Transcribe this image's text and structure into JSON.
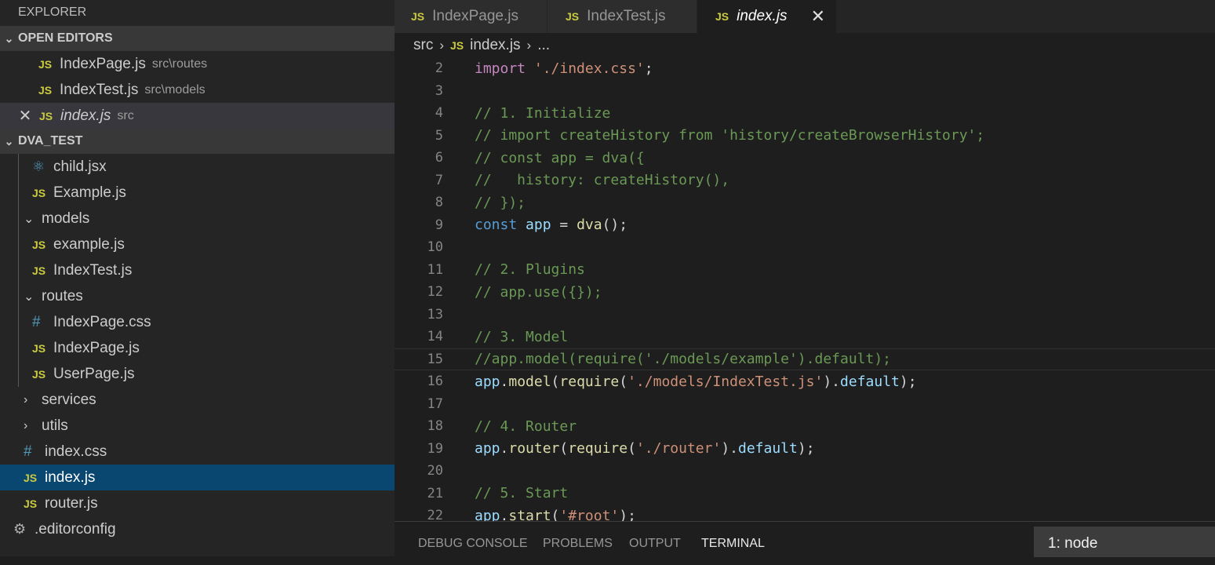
{
  "explorer": {
    "title": "EXPLORER",
    "open_editors": {
      "header": "OPEN EDITORS",
      "items": [
        {
          "name": "IndexPage.js",
          "path": "src\\routes"
        },
        {
          "name": "IndexTest.js",
          "path": "src\\models"
        },
        {
          "name": "index.js",
          "path": "src"
        }
      ]
    },
    "project": {
      "header": "DVA_TEST",
      "items": [
        {
          "label": "child.jsx",
          "icon": "react-icon"
        },
        {
          "label": "Example.js",
          "icon": "js-icon"
        },
        {
          "label": "models",
          "icon": "chevron-down-icon"
        },
        {
          "label": "example.js",
          "icon": "js-icon"
        },
        {
          "label": "IndexTest.js",
          "icon": "js-icon"
        },
        {
          "label": "routes",
          "icon": "chevron-down-icon"
        },
        {
          "label": "IndexPage.css",
          "icon": "css-icon"
        },
        {
          "label": "IndexPage.js",
          "icon": "js-icon"
        },
        {
          "label": "UserPage.js",
          "icon": "js-icon"
        },
        {
          "label": "services",
          "icon": "chevron-right-icon"
        },
        {
          "label": "utils",
          "icon": "chevron-right-icon"
        },
        {
          "label": "index.css",
          "icon": "css-icon"
        },
        {
          "label": "index.js",
          "icon": "js-icon"
        },
        {
          "label": "router.js",
          "icon": "js-icon"
        },
        {
          "label": ".editorconfig",
          "icon": "gear-icon"
        }
      ]
    }
  },
  "icons": {
    "js": "JS",
    "css": "#",
    "react": "⚛",
    "gear": "⚙",
    "close": "✕",
    "chevron_down": "⌄",
    "chevron_right": "›"
  },
  "tabs": [
    {
      "label": "IndexPage.js"
    },
    {
      "label": "IndexTest.js"
    },
    {
      "label": "index.js",
      "active": true
    }
  ],
  "breadcrumb": {
    "folder": "src",
    "file": "index.js",
    "more": "..."
  },
  "editor": {
    "lines": [
      {
        "n": "2",
        "tokens": [
          [
            "kw",
            "import"
          ],
          [
            "plain",
            " "
          ],
          [
            "str",
            "'./index.css'"
          ],
          [
            "plain",
            ";"
          ]
        ]
      },
      {
        "n": "3",
        "tokens": []
      },
      {
        "n": "4",
        "tokens": [
          [
            "comment",
            "// 1. Initialize"
          ]
        ]
      },
      {
        "n": "5",
        "tokens": [
          [
            "comment",
            "// import createHistory from 'history/createBrowserHistory';"
          ]
        ]
      },
      {
        "n": "6",
        "tokens": [
          [
            "comment",
            "// const app = dva({"
          ]
        ]
      },
      {
        "n": "7",
        "tokens": [
          [
            "comment",
            "//   history: createHistory(),"
          ]
        ]
      },
      {
        "n": "8",
        "tokens": [
          [
            "comment",
            "// });"
          ]
        ]
      },
      {
        "n": "9",
        "tokens": [
          [
            "decl",
            "const"
          ],
          [
            "plain",
            " "
          ],
          [
            "var",
            "app"
          ],
          [
            "plain",
            " = "
          ],
          [
            "fn",
            "dva"
          ],
          [
            "plain",
            "();"
          ]
        ]
      },
      {
        "n": "10",
        "tokens": []
      },
      {
        "n": "11",
        "tokens": [
          [
            "comment",
            "// 2. Plugins"
          ]
        ]
      },
      {
        "n": "12",
        "tokens": [
          [
            "comment",
            "// app.use({});"
          ]
        ]
      },
      {
        "n": "13",
        "tokens": []
      },
      {
        "n": "14",
        "tokens": [
          [
            "comment",
            "// 3. Model"
          ]
        ]
      },
      {
        "n": "15",
        "tokens": [
          [
            "comment",
            "//app.model(require('./models/example').default);"
          ]
        ],
        "current": true
      },
      {
        "n": "16",
        "tokens": [
          [
            "var",
            "app"
          ],
          [
            "plain",
            "."
          ],
          [
            "fn",
            "model"
          ],
          [
            "plain",
            "("
          ],
          [
            "fn",
            "require"
          ],
          [
            "plain",
            "("
          ],
          [
            "str",
            "'./models/IndexTest.js'"
          ],
          [
            "plain",
            ")."
          ],
          [
            "var",
            "default"
          ],
          [
            "plain",
            ");"
          ]
        ]
      },
      {
        "n": "17",
        "tokens": []
      },
      {
        "n": "18",
        "tokens": [
          [
            "comment",
            "// 4. Router"
          ]
        ]
      },
      {
        "n": "19",
        "tokens": [
          [
            "var",
            "app"
          ],
          [
            "plain",
            "."
          ],
          [
            "fn",
            "router"
          ],
          [
            "plain",
            "("
          ],
          [
            "fn",
            "require"
          ],
          [
            "plain",
            "("
          ],
          [
            "str",
            "'./router'"
          ],
          [
            "plain",
            ")."
          ],
          [
            "var",
            "default"
          ],
          [
            "plain",
            ");"
          ]
        ]
      },
      {
        "n": "20",
        "tokens": []
      },
      {
        "n": "21",
        "tokens": [
          [
            "comment",
            "// 5. Start"
          ]
        ]
      },
      {
        "n": "22",
        "tokens": [
          [
            "var",
            "app"
          ],
          [
            "plain",
            "."
          ],
          [
            "fn",
            "start"
          ],
          [
            "plain",
            "("
          ],
          [
            "str",
            "'#root'"
          ],
          [
            "plain",
            ");"
          ]
        ]
      }
    ]
  },
  "panel": {
    "tabs": [
      "DEBUG CONSOLE",
      "PROBLEMS",
      "OUTPUT",
      "TERMINAL"
    ],
    "active": "TERMINAL",
    "terminal_select": "1: node"
  }
}
